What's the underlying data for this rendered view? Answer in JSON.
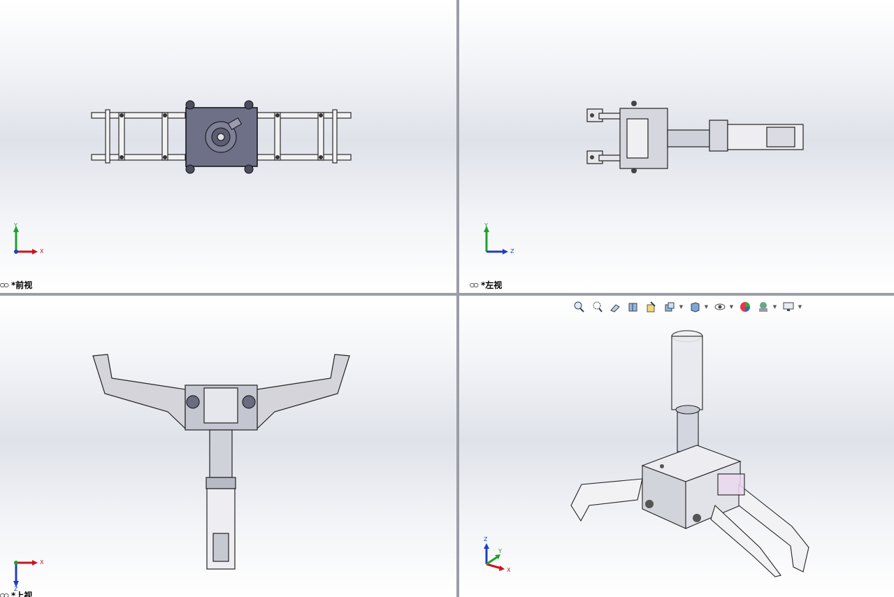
{
  "viewports": {
    "front": {
      "label": "*前视",
      "axes": {
        "h": "X",
        "v": "Y"
      }
    },
    "left": {
      "label": "*左视",
      "axes": {
        "h": "Z",
        "v": "Y"
      }
    },
    "top": {
      "label": "*上视",
      "axes": {
        "h": "X",
        "v": "Z"
      }
    },
    "iso": {
      "axes": {
        "a": "Z",
        "b": "Y",
        "c": "X"
      }
    }
  },
  "heads_up_toolbar": {
    "tools": [
      "zoom-to-fit-icon",
      "zoom-to-area-icon",
      "previous-view-icon",
      "section-view-icon",
      "dynamic-annotation-icon",
      "view-orientation-icon",
      "display-style-icon",
      "hide-show-items-icon",
      "edit-appearance-icon",
      "apply-scene-icon",
      "view-settings-icon"
    ]
  },
  "colors": {
    "axis_x": "#c8141e",
    "axis_y": "#1aa32a",
    "axis_z": "#1f3fc0",
    "model_line": "#222222",
    "model_fill": "#6e7088"
  }
}
